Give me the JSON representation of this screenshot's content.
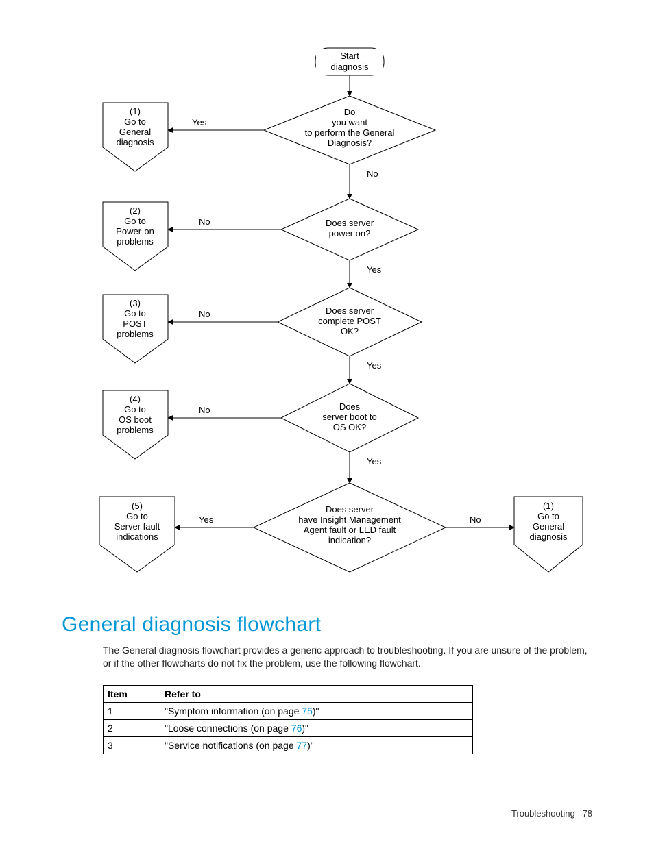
{
  "chart_data": {
    "type": "flowchart",
    "title": "General diagnosis flowchart (Start diagnosis)",
    "nodes": [
      {
        "id": "start",
        "kind": "terminator",
        "text": "Start diagnosis"
      },
      {
        "id": "d1",
        "kind": "decision",
        "text": "Do you want to perform the General Diagnosis?"
      },
      {
        "id": "d2",
        "kind": "decision",
        "text": "Does server power on?"
      },
      {
        "id": "d3",
        "kind": "decision",
        "text": "Does server complete POST OK?"
      },
      {
        "id": "d4",
        "kind": "decision",
        "text": "Does server boot to OS OK?"
      },
      {
        "id": "d5",
        "kind": "decision",
        "text": "Does server have Insight Management Agent fault or LED fault indication?"
      },
      {
        "id": "off1",
        "kind": "offpage",
        "text": "(1) Go to General diagnosis"
      },
      {
        "id": "off2",
        "kind": "offpage",
        "text": "(2) Go to Power-on problems"
      },
      {
        "id": "off3",
        "kind": "offpage",
        "text": "(3) Go to POST problems"
      },
      {
        "id": "off4",
        "kind": "offpage",
        "text": "(4) Go to OS boot problems"
      },
      {
        "id": "off5",
        "kind": "offpage",
        "text": "(5) Go to Server fault indications"
      },
      {
        "id": "off1b",
        "kind": "offpage",
        "text": "(1) Go to General diagnosis"
      }
    ],
    "edges": [
      {
        "from": "start",
        "to": "d1",
        "label": ""
      },
      {
        "from": "d1",
        "to": "off1",
        "label": "Yes"
      },
      {
        "from": "d1",
        "to": "d2",
        "label": "No"
      },
      {
        "from": "d2",
        "to": "off2",
        "label": "No"
      },
      {
        "from": "d2",
        "to": "d3",
        "label": "Yes"
      },
      {
        "from": "d3",
        "to": "off3",
        "label": "No"
      },
      {
        "from": "d3",
        "to": "d4",
        "label": "Yes"
      },
      {
        "from": "d4",
        "to": "off4",
        "label": "No"
      },
      {
        "from": "d4",
        "to": "d5",
        "label": "Yes"
      },
      {
        "from": "d5",
        "to": "off5",
        "label": "Yes"
      },
      {
        "from": "d5",
        "to": "off1b",
        "label": "No"
      }
    ]
  },
  "flow": {
    "start": "Start diagnosis",
    "d1_l1": "Do",
    "d1_l2": "you want",
    "d1_l3": "to perform the General",
    "d1_l4": "Diagnosis?",
    "d2_l1": "Does server",
    "d2_l2": "power on?",
    "d3_l1": "Does server",
    "d3_l2": "complete POST",
    "d3_l3": "OK?",
    "d4_l1": "Does",
    "d4_l2": "server boot to",
    "d4_l3": "OS OK?",
    "d5_l1": "Does server",
    "d5_l2": "have Insight Management",
    "d5_l3": "Agent fault or LED fault",
    "d5_l4": "indication?",
    "off1_l1": "(1)",
    "off1_l2": "Go to",
    "off1_l3": "General",
    "off1_l4": "diagnosis",
    "off2_l1": "(2)",
    "off2_l2": "Go to",
    "off2_l3": "Power-on",
    "off2_l4": "problems",
    "off3_l1": "(3)",
    "off3_l2": "Go to",
    "off3_l3": "POST",
    "off3_l4": "problems",
    "off4_l1": "(4)",
    "off4_l2": "Go to",
    "off4_l3": "OS boot",
    "off4_l4": "problems",
    "off5_l1": "(5)",
    "off5_l2": "Go to",
    "off5_l3": "Server fault",
    "off5_l4": "indications",
    "off1b_l1": "(1)",
    "off1b_l2": "Go to",
    "off1b_l3": "General",
    "off1b_l4": "diagnosis",
    "yes": "Yes",
    "no": "No"
  },
  "heading": "General diagnosis flowchart",
  "paragraph": "The General diagnosis flowchart provides a generic approach to troubleshooting. If you are unsure of the problem, or if the other flowcharts do not fix the problem, use the following flowchart.",
  "table": {
    "h_item": "Item",
    "h_refer": "Refer to",
    "r1_item": "1",
    "r1_pre": "\"Symptom information (on page ",
    "r1_link": "75",
    "r1_post": ")\"",
    "r2_item": "2",
    "r2_pre": "\"Loose connections (on page ",
    "r2_link": "76",
    "r2_post": ")\"",
    "r3_item": "3",
    "r3_pre": "\"Service notifications (on page ",
    "r3_link": "77",
    "r3_post": ")\""
  },
  "footer": {
    "section": "Troubleshooting",
    "page": "78"
  }
}
